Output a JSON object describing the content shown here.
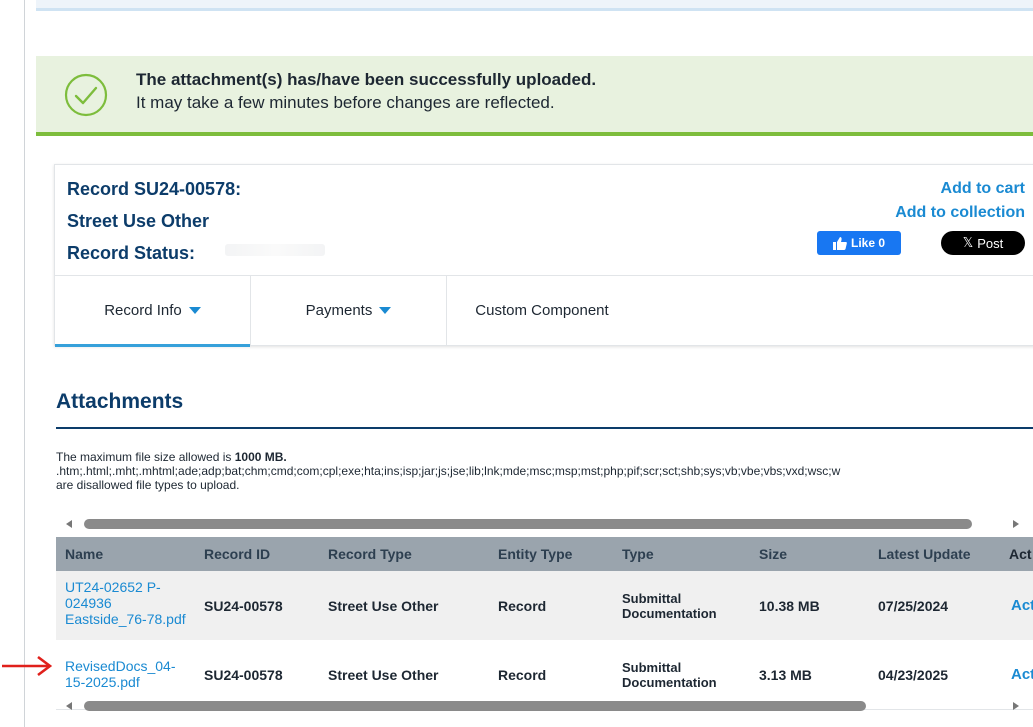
{
  "banner": {
    "title": "The attachment(s) has/have been successfully uploaded.",
    "subtitle": "It may take a few minutes before changes are reflected."
  },
  "record": {
    "id_line": "Record SU24-00578:",
    "type_line": "Street Use Other",
    "status_label": "Record Status:"
  },
  "actions": {
    "add_to_cart": "Add to cart",
    "add_to_collection": "Add to collection"
  },
  "social": {
    "like_label": "Like 0",
    "post_label": "Post"
  },
  "tabs": [
    {
      "label": "Record Info",
      "dropdown": true,
      "active": true
    },
    {
      "label": "Payments",
      "dropdown": true,
      "active": false
    },
    {
      "label": "Custom Component",
      "dropdown": false,
      "active": false
    }
  ],
  "attachments": {
    "title": "Attachments",
    "max_size_prefix": "The maximum file size allowed is ",
    "max_size_value": "1000 MB.",
    "disallowed_types": ".htm;.html;.mht;.mhtml;ade;adp;bat;chm;cmd;com;cpl;exe;hta;ins;isp;jar;js;jse;lib;lnk;mde;msc;msp;mst;php;pif;scr;sct;shb;sys;vb;vbe;vbs;vxd;wsc;w",
    "disallowed_note": "are disallowed file types to upload.",
    "columns": [
      "Name",
      "Record ID",
      "Record Type",
      "Entity Type",
      "Type",
      "Size",
      "Latest Update",
      "Act"
    ],
    "rows": [
      {
        "name": "UT24-02652 P-024936 Eastside_76-78.pdf",
        "record_id": "SU24-00578",
        "record_type": "Street Use Other",
        "entity_type": "Record",
        "type": "Submittal Documentation",
        "size": "10.38 MB",
        "latest_update": "07/25/2024",
        "action": "Act"
      },
      {
        "name": "RevisedDocs_04-15-2025.pdf",
        "record_id": "SU24-00578",
        "record_type": "Street Use Other",
        "entity_type": "Record",
        "type": "Submittal Documentation",
        "size": "3.13 MB",
        "latest_update": "04/23/2025",
        "action": "Act"
      }
    ]
  },
  "colors": {
    "banner_bg": "#e8f2df",
    "banner_border": "#7dbd3c",
    "link": "#1a8ad2",
    "heading": "#0c3c6a",
    "table_header": "#9aa4ad",
    "arrow": "#e0201b"
  },
  "icons": [
    "check-circle-icon",
    "thumbs-up-icon",
    "x-logo-icon",
    "caret-down-icon",
    "red-arrow-icon"
  ]
}
